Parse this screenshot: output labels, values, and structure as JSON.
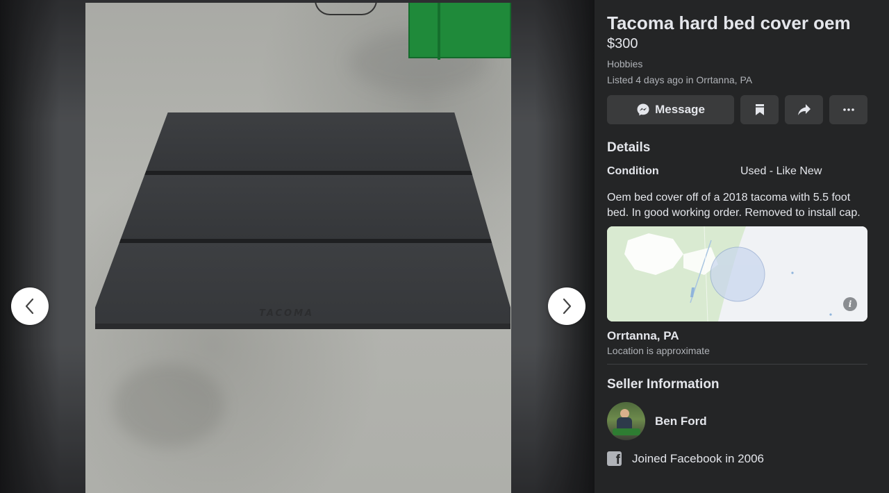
{
  "viewer": {
    "prev_icon": "chevron-left-icon",
    "next_icon": "chevron-right-icon",
    "photo_brand_text": "TACOMA"
  },
  "listing": {
    "title": "Tacoma hard bed cover oem",
    "price": "$300",
    "category": "Hobbies",
    "listed": "Listed 4 days ago in Orrtanna, PA"
  },
  "actions": {
    "message_label": "Message",
    "message_icon": "messenger-icon",
    "save_icon": "bookmark-icon",
    "share_icon": "share-icon",
    "more_icon": "more-icon"
  },
  "details": {
    "heading": "Details",
    "condition_label": "Condition",
    "condition_value": "Used - Like New",
    "description": "Oem bed cover off of a 2018 tacoma with 5.5 foot bed. In good working order. Removed to install cap."
  },
  "location": {
    "name": "Orrtanna, PA",
    "note": "Location is approximate",
    "info_icon": "info-icon"
  },
  "seller": {
    "heading": "Seller Information",
    "name": "Ben Ford",
    "joined": "Joined Facebook in 2006",
    "joined_icon": "facebook-icon"
  },
  "colors": {
    "panel_bg": "#242526",
    "button_bg": "#3a3b3c",
    "text_primary": "#e4e6eb",
    "text_secondary": "#b0b3b8"
  }
}
